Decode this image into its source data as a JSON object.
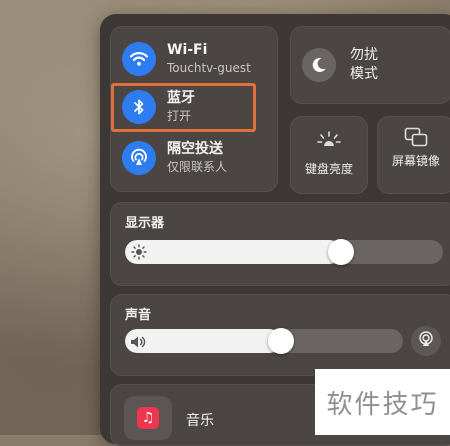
{
  "connectivity": {
    "wifi": {
      "title": "Wi-Fi",
      "subtitle": "Touchtv-guest"
    },
    "bluetooth": {
      "title": "蓝牙",
      "subtitle": "打开"
    },
    "airdrop": {
      "title": "隔空投送",
      "subtitle": "仅限联系人"
    }
  },
  "dnd": {
    "label": "勿扰模式"
  },
  "keyboard_brightness": {
    "label": "键盘亮度"
  },
  "screen_mirroring": {
    "label": "屏幕镜像"
  },
  "display": {
    "title": "显示器",
    "level": 0.68
  },
  "sound": {
    "title": "声音",
    "level": 0.56
  },
  "now_playing": {
    "label": "音乐"
  },
  "watermark": {
    "text": "软件技巧"
  },
  "colors": {
    "accent": "#2f7cf0",
    "highlight": "#e0703a",
    "music": "#f0364f"
  }
}
